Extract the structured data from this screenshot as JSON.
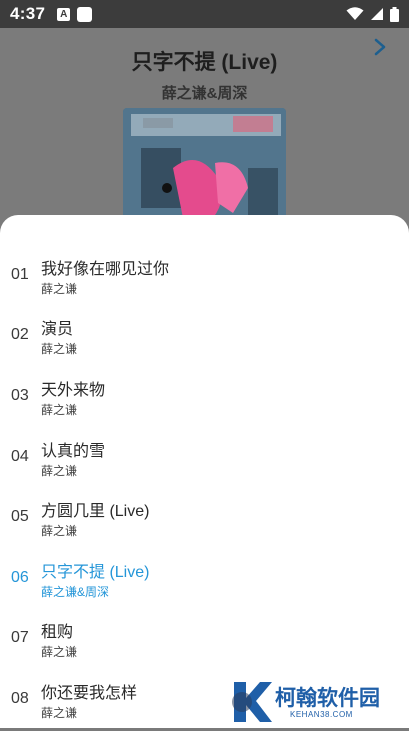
{
  "status": {
    "time": "4:37",
    "notif_letter": "A"
  },
  "player": {
    "title": "只字不提 (Live)",
    "artist": "薛之谦&周深"
  },
  "playlist": [
    {
      "num": "01",
      "name": "我好像在哪见过你",
      "artist": "薛之谦",
      "active": false
    },
    {
      "num": "02",
      "name": "演员",
      "artist": "薛之谦",
      "active": false
    },
    {
      "num": "03",
      "name": "天外来物",
      "artist": "薛之谦",
      "active": false
    },
    {
      "num": "04",
      "name": "认真的雪",
      "artist": "薛之谦",
      "active": false
    },
    {
      "num": "05",
      "name": "方圆几里 (Live)",
      "artist": "薛之谦",
      "active": false
    },
    {
      "num": "06",
      "name": "只字不提 (Live)",
      "artist": "薛之谦&周深",
      "active": true
    },
    {
      "num": "07",
      "name": "租购",
      "artist": "薛之谦",
      "active": false
    },
    {
      "num": "08",
      "name": "你还要我怎样",
      "artist": "薛之谦",
      "active": false
    }
  ],
  "watermark": {
    "title": "柯翰软件园",
    "sub": "KEHAN38.COM"
  },
  "colors": {
    "accent": "#2596d8",
    "status_bar": "#3c3c3c",
    "overlay": "#7b7b7b",
    "watermark": "#1f5fa8"
  },
  "icons": [
    "wifi-icon",
    "signal-icon",
    "battery-icon",
    "next-icon"
  ]
}
